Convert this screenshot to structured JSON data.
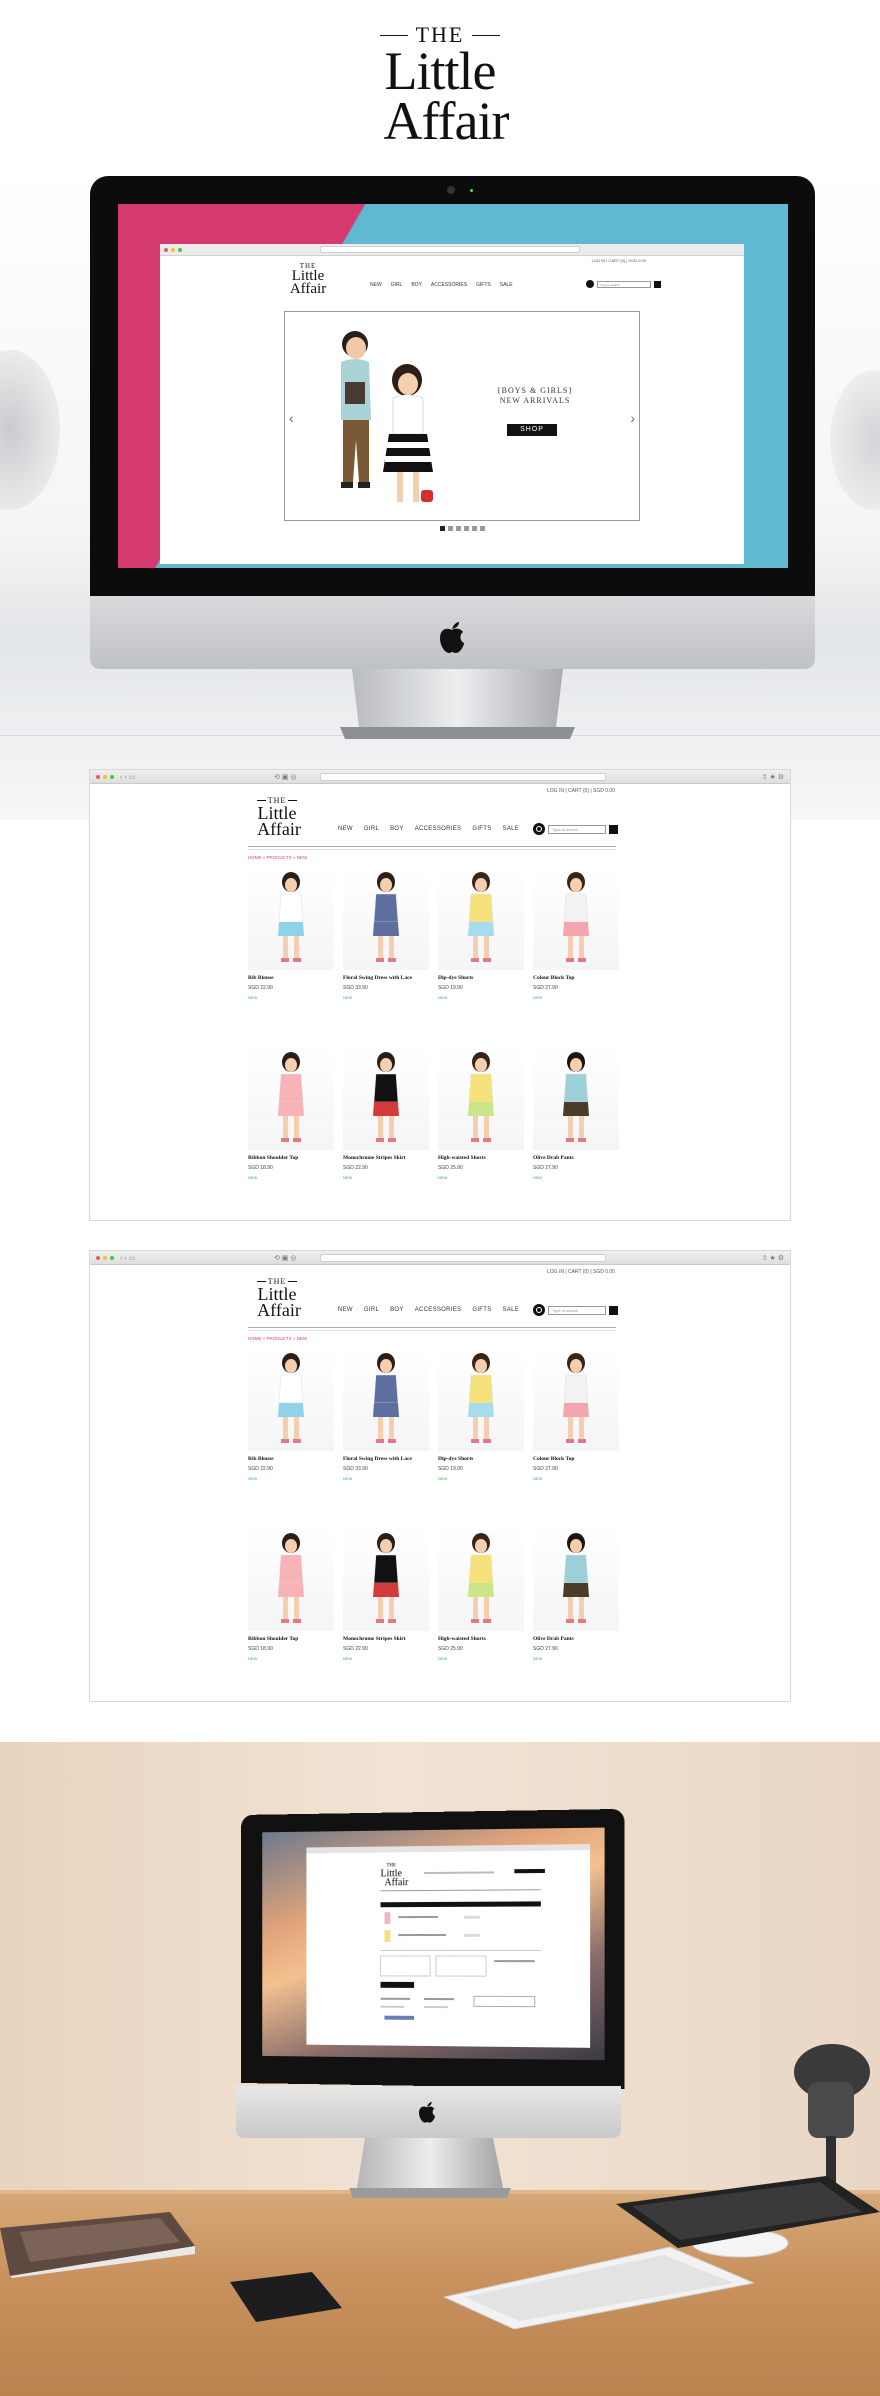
{
  "brand": {
    "the": "THE",
    "line1": "Little",
    "line2": "Affair"
  },
  "colors": {
    "accent": "#e0455a",
    "in_stock": "#3bb34a",
    "hero_pink": "#d43a6e",
    "hero_blue": "#5fb9d0"
  },
  "header": {
    "account_links": "LOG IN  |  CART (0)  |  SGD 0.00",
    "nav": [
      "NEW",
      "GIRL",
      "BOY",
      "ACCESSORIES",
      "GIFTS",
      "SALE"
    ],
    "search_placeholder": "Type to search"
  },
  "hero": {
    "line1": "{BOYS & GIRLS}",
    "line2": "NEW ARRIVALS",
    "cta": "SHOP",
    "prev_icon": "chevron-left-icon",
    "next_icon": "chevron-right-icon",
    "slides": 6,
    "active_slide": 1
  },
  "breadcrumb": "HOME  »  PRODUCTS  »  NEW",
  "products": [
    {
      "name": "Rib Blouse",
      "price": "SGD 22.90",
      "status": "NEW"
    },
    {
      "name": "Floral Swing Dress with Lace",
      "price": "SGD 33.90",
      "status": "NEW"
    },
    {
      "name": "Dip-dye Shorts",
      "price": "SGD 19.90",
      "status": "NEW"
    },
    {
      "name": "Colour Block Top",
      "price": "SGD 27.90",
      "status": "NEW"
    },
    {
      "name": "Ribbon Shoulder Top",
      "price": "SGD 18.90",
      "status": "NEW"
    },
    {
      "name": "Monochrome Stripes Skirt",
      "price": "SGD 22.90",
      "status": "NEW"
    },
    {
      "name": "High-waisted Shorts",
      "price": "SGD 25.90",
      "status": "NEW"
    },
    {
      "name": "Olive Drab Pants",
      "price": "SGD 27.90",
      "status": "NEW"
    }
  ]
}
